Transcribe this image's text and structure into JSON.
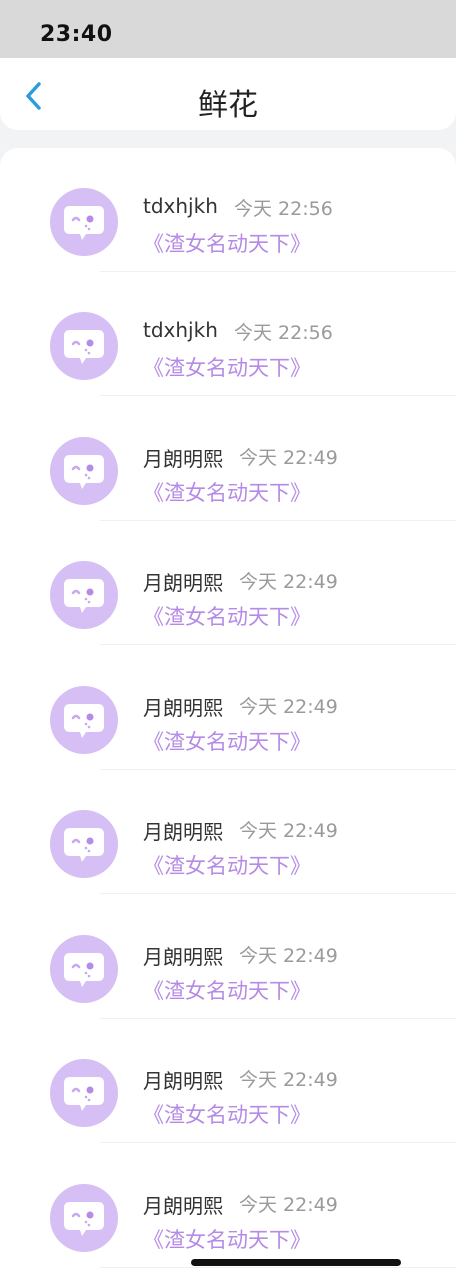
{
  "status_bar": {
    "time": "23:40"
  },
  "nav": {
    "title": "鲜花",
    "back_icon": "chevron-left-icon"
  },
  "colors": {
    "accent": "#2d9cdb",
    "avatar_bg": "#d5bff5",
    "book_title": "#b58be6",
    "time_text": "#9a9a9a"
  },
  "items": [
    {
      "name": "tdxhjkh",
      "time": "今天 22:56",
      "book": "《渣女名动天下》",
      "avatar_icon": "chat-bubble-face-icon"
    },
    {
      "name": "tdxhjkh",
      "time": "今天 22:56",
      "book": "《渣女名动天下》",
      "avatar_icon": "chat-bubble-face-icon"
    },
    {
      "name": "月朗明熙",
      "time": "今天 22:49",
      "book": "《渣女名动天下》",
      "avatar_icon": "chat-bubble-face-icon"
    },
    {
      "name": "月朗明熙",
      "time": "今天 22:49",
      "book": "《渣女名动天下》",
      "avatar_icon": "chat-bubble-face-icon"
    },
    {
      "name": "月朗明熙",
      "time": "今天 22:49",
      "book": "《渣女名动天下》",
      "avatar_icon": "chat-bubble-face-icon"
    },
    {
      "name": "月朗明熙",
      "time": "今天 22:49",
      "book": "《渣女名动天下》",
      "avatar_icon": "chat-bubble-face-icon"
    },
    {
      "name": "月朗明熙",
      "time": "今天 22:49",
      "book": "《渣女名动天下》",
      "avatar_icon": "chat-bubble-face-icon"
    },
    {
      "name": "月朗明熙",
      "time": "今天 22:49",
      "book": "《渣女名动天下》",
      "avatar_icon": "chat-bubble-face-icon"
    },
    {
      "name": "月朗明熙",
      "time": "今天 22:49",
      "book": "《渣女名动天下》",
      "avatar_icon": "chat-bubble-face-icon"
    }
  ]
}
